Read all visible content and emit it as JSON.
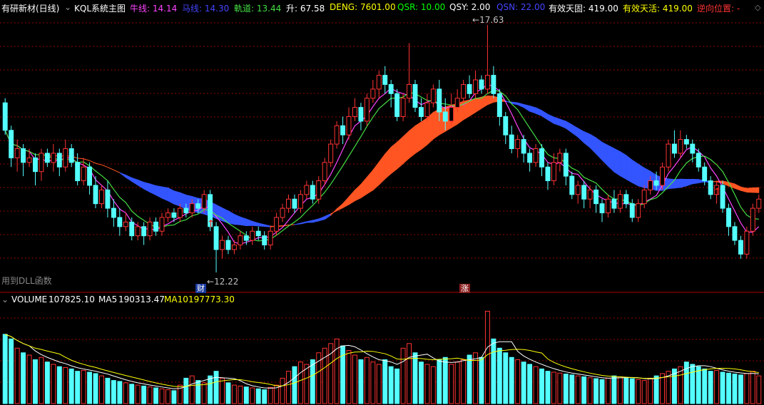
{
  "header": {
    "title": "有研新材(日线)",
    "indicator_name": "KQL系統主图",
    "items": [
      {
        "label": "牛线",
        "value": "14.14",
        "color": "#ff44ff"
      },
      {
        "label": "马线",
        "value": "14.30",
        "color": "#4444ff"
      },
      {
        "label": "軌道",
        "value": "13.44",
        "color": "#44dd44"
      },
      {
        "label": "升",
        "value": "67.58",
        "color": "#ffffff"
      },
      {
        "label": "DENG",
        "value": "7601.00",
        "color": "#ffff00"
      },
      {
        "label": "QSR",
        "value": "10.00",
        "color": "#00ff00"
      },
      {
        "label": "QSY",
        "value": "2.00",
        "color": "#ffffff"
      },
      {
        "label": "QSN",
        "value": "22.00",
        "color": "#4444ff"
      },
      {
        "label": "有效天固",
        "value": "419.00",
        "color": "#ffffff"
      },
      {
        "label": "有效天活",
        "value": "419.00",
        "color": "#ffff00"
      },
      {
        "label": "逆向位置",
        "value": "-",
        "color": "#ff3333"
      }
    ]
  },
  "price_panel": {
    "high_label": "17.63",
    "low_label": "12.22",
    "dll_note": "用到DLL函数",
    "tag_cai": "财",
    "tag_zhang": "涨"
  },
  "volume_header": {
    "volume_label": "VOLUME",
    "volume_value": "107825.10",
    "ma5_label": "MA5",
    "ma5_value": "190313.47",
    "ma10_label": "MA10",
    "ma10_value": "197773.30"
  },
  "colors": {
    "up": "#ff3333",
    "down": "#54ffff",
    "blue_band": "#3355ff",
    "red_band": "#ff5522",
    "olive": "#999922",
    "magenta": "#ff44ff",
    "green": "#44dd44",
    "grid": "#8b0000"
  },
  "chart_data": {
    "type": "candlestick",
    "ylim": [
      12.0,
      17.8
    ],
    "candles": [
      [
        15.9,
        15.3,
        16.0,
        15.2
      ],
      [
        15.3,
        14.7,
        15.4,
        14.5
      ],
      [
        14.7,
        14.9,
        15.1,
        14.4
      ],
      [
        14.9,
        14.6,
        15.0,
        14.3
      ],
      [
        14.6,
        14.7,
        14.9,
        14.5
      ],
      [
        14.7,
        14.4,
        14.8,
        14.1
      ],
      [
        14.4,
        14.8,
        14.9,
        14.2
      ],
      [
        14.8,
        14.6,
        14.9,
        14.5
      ],
      [
        14.6,
        14.8,
        15.0,
        14.4
      ],
      [
        14.8,
        14.5,
        14.9,
        14.3
      ],
      [
        14.5,
        14.9,
        15.1,
        14.4
      ],
      [
        14.9,
        14.6,
        15.0,
        14.5
      ],
      [
        14.6,
        14.2,
        14.8,
        14.1
      ],
      [
        14.2,
        14.5,
        14.7,
        14.1
      ],
      [
        14.5,
        14.1,
        14.6,
        13.9
      ],
      [
        14.1,
        13.7,
        14.3,
        13.6
      ],
      [
        13.7,
        14.0,
        14.1,
        13.6
      ],
      [
        14.0,
        13.6,
        14.2,
        13.4
      ],
      [
        13.6,
        13.4,
        13.8,
        13.2
      ],
      [
        13.4,
        13.2,
        13.6,
        13.0
      ],
      [
        13.2,
        13.3,
        13.5,
        13.1
      ],
      [
        13.3,
        13.0,
        13.4,
        12.9
      ],
      [
        13.0,
        13.2,
        13.3,
        12.9
      ],
      [
        13.2,
        13.0,
        13.3,
        12.8
      ],
      [
        13.0,
        13.3,
        13.4,
        12.9
      ],
      [
        13.3,
        13.1,
        13.4,
        13.0
      ],
      [
        13.1,
        13.4,
        13.5,
        13.0
      ],
      [
        13.4,
        13.5,
        13.6,
        13.3
      ],
      [
        13.5,
        13.4,
        13.6,
        13.3
      ],
      [
        13.4,
        13.6,
        13.7,
        13.3
      ],
      [
        13.6,
        13.5,
        13.7,
        13.4
      ],
      [
        13.5,
        13.7,
        13.8,
        13.4
      ],
      [
        13.7,
        13.6,
        13.8,
        13.5
      ],
      [
        13.6,
        13.9,
        14.0,
        13.5
      ],
      [
        13.9,
        13.2,
        14.0,
        13.1
      ],
      [
        13.2,
        12.7,
        13.3,
        12.2
      ],
      [
        12.7,
        12.9,
        13.0,
        12.5
      ],
      [
        12.9,
        12.7,
        13.0,
        12.6
      ],
      [
        12.7,
        12.8,
        12.9,
        12.6
      ],
      [
        12.8,
        13.0,
        13.1,
        12.7
      ],
      [
        13.0,
        12.9,
        13.1,
        12.8
      ],
      [
        12.9,
        13.1,
        13.2,
        12.8
      ],
      [
        13.1,
        13.0,
        13.2,
        12.9
      ],
      [
        13.0,
        12.8,
        13.1,
        12.7
      ],
      [
        12.8,
        13.1,
        13.2,
        12.7
      ],
      [
        13.1,
        13.4,
        13.5,
        13.0
      ],
      [
        13.4,
        13.6,
        13.7,
        13.3
      ],
      [
        13.6,
        13.8,
        13.9,
        13.5
      ],
      [
        13.8,
        13.6,
        13.9,
        13.5
      ],
      [
        13.6,
        13.9,
        14.0,
        13.5
      ],
      [
        13.9,
        14.1,
        14.2,
        13.8
      ],
      [
        14.1,
        13.8,
        14.2,
        13.7
      ],
      [
        13.8,
        14.2,
        14.3,
        13.7
      ],
      [
        14.2,
        14.6,
        14.7,
        14.1
      ],
      [
        14.6,
        15.0,
        15.1,
        14.5
      ],
      [
        15.0,
        15.4,
        15.5,
        14.9
      ],
      [
        15.4,
        15.2,
        15.6,
        15.0
      ],
      [
        15.2,
        15.6,
        15.8,
        15.1
      ],
      [
        15.6,
        15.8,
        16.0,
        15.5
      ],
      [
        15.8,
        15.5,
        15.9,
        15.3
      ],
      [
        15.5,
        16.0,
        16.1,
        15.4
      ],
      [
        16.0,
        16.2,
        16.4,
        15.9
      ],
      [
        16.2,
        16.5,
        16.6,
        16.0
      ],
      [
        16.5,
        16.3,
        16.7,
        16.1
      ],
      [
        16.3,
        16.1,
        16.4,
        15.8
      ],
      [
        16.1,
        15.6,
        16.2,
        15.5
      ],
      [
        15.6,
        16.0,
        16.1,
        15.5
      ],
      [
        16.0,
        16.3,
        17.2,
        15.9
      ],
      [
        16.3,
        15.8,
        16.4,
        15.7
      ],
      [
        15.8,
        15.6,
        16.0,
        15.5
      ],
      [
        15.6,
        15.9,
        16.1,
        15.5
      ],
      [
        15.9,
        16.2,
        16.3,
        15.8
      ],
      [
        16.2,
        15.7,
        16.4,
        15.5
      ],
      [
        15.7,
        15.5,
        16.0,
        15.3
      ],
      [
        15.5,
        15.8,
        16.1,
        15.4
      ],
      [
        15.8,
        16.0,
        16.2,
        15.7
      ],
      [
        16.0,
        16.3,
        16.4,
        15.9
      ],
      [
        16.3,
        16.1,
        16.5,
        16.0
      ],
      [
        16.1,
        16.4,
        16.6,
        16.0
      ],
      [
        16.4,
        16.2,
        16.5,
        16.1
      ],
      [
        16.2,
        16.5,
        17.6,
        16.1
      ],
      [
        16.5,
        16.1,
        16.7,
        16.0
      ],
      [
        16.1,
        15.6,
        16.2,
        15.4
      ],
      [
        15.6,
        15.2,
        15.7,
        15.0
      ],
      [
        15.2,
        14.9,
        15.4,
        14.8
      ],
      [
        14.9,
        15.1,
        15.2,
        14.7
      ],
      [
        15.1,
        14.8,
        15.2,
        14.6
      ],
      [
        14.8,
        14.6,
        14.9,
        14.4
      ],
      [
        14.6,
        14.9,
        15.0,
        14.5
      ],
      [
        14.9,
        14.5,
        15.0,
        14.3
      ],
      [
        14.5,
        14.2,
        14.6,
        14.0
      ],
      [
        14.2,
        14.6,
        14.8,
        14.1
      ],
      [
        14.6,
        14.8,
        14.9,
        14.4
      ],
      [
        14.8,
        14.3,
        14.9,
        14.1
      ],
      [
        14.3,
        13.9,
        14.4,
        13.8
      ],
      [
        13.9,
        14.1,
        14.2,
        13.7
      ],
      [
        14.1,
        13.8,
        14.2,
        13.6
      ],
      [
        13.8,
        14.0,
        14.1,
        13.6
      ],
      [
        14.0,
        13.7,
        14.1,
        13.5
      ],
      [
        13.7,
        13.5,
        13.8,
        13.3
      ],
      [
        13.5,
        13.8,
        13.9,
        13.4
      ],
      [
        13.8,
        13.6,
        14.0,
        13.5
      ],
      [
        13.6,
        13.9,
        14.0,
        13.5
      ],
      [
        13.9,
        13.7,
        14.0,
        13.6
      ],
      [
        13.7,
        13.4,
        13.8,
        13.3
      ],
      [
        13.4,
        13.7,
        13.8,
        13.3
      ],
      [
        13.7,
        14.0,
        14.1,
        13.6
      ],
      [
        14.0,
        14.2,
        14.3,
        13.9
      ],
      [
        14.2,
        14.1,
        14.4,
        14.0
      ],
      [
        14.1,
        14.5,
        14.6,
        14.0
      ],
      [
        14.5,
        15.0,
        15.1,
        14.4
      ],
      [
        15.0,
        14.8,
        15.3,
        14.7
      ],
      [
        14.8,
        15.1,
        15.3,
        14.7
      ],
      [
        15.1,
        15.0,
        15.2,
        14.9
      ],
      [
        15.0,
        14.8,
        15.1,
        14.6
      ],
      [
        14.8,
        14.5,
        14.9,
        14.4
      ],
      [
        14.5,
        14.2,
        14.6,
        14.1
      ],
      [
        14.2,
        13.9,
        14.3,
        13.8
      ],
      [
        13.9,
        14.1,
        14.2,
        13.7
      ],
      [
        14.1,
        13.6,
        14.2,
        13.5
      ],
      [
        13.6,
        13.2,
        13.7,
        13.0
      ],
      [
        13.2,
        12.9,
        13.3,
        12.8
      ],
      [
        12.9,
        12.6,
        13.0,
        12.5
      ],
      [
        12.6,
        13.1,
        13.2,
        12.5
      ],
      [
        13.1,
        13.6,
        13.7,
        13.0
      ],
      [
        13.6,
        13.8,
        13.9,
        13.5
      ]
    ],
    "volume": [
      150,
      140,
      120,
      110,
      105,
      95,
      100,
      90,
      85,
      80,
      78,
      75,
      70,
      72,
      68,
      65,
      60,
      55,
      50,
      48,
      45,
      42,
      40,
      38,
      36,
      34,
      32,
      30,
      28,
      40,
      55,
      60,
      50,
      45,
      60,
      70,
      55,
      45,
      40,
      38,
      36,
      34,
      32,
      30,
      35,
      40,
      55,
      70,
      80,
      90,
      85,
      95,
      110,
      120,
      130,
      140,
      125,
      115,
      105,
      95,
      100,
      90,
      85,
      95,
      80,
      75,
      120,
      130,
      110,
      90,
      85,
      80,
      95,
      100,
      85,
      90,
      95,
      105,
      110,
      100,
      200,
      140,
      120,
      110,
      100,
      95,
      90,
      85,
      80,
      75,
      70,
      68,
      66,
      64,
      62,
      60,
      58,
      56,
      54,
      52,
      55,
      60,
      58,
      56,
      54,
      52,
      50,
      55,
      60,
      65,
      70,
      75,
      80,
      90,
      85,
      80,
      75,
      70,
      72,
      68,
      66,
      64,
      62,
      65,
      70,
      60
    ]
  }
}
